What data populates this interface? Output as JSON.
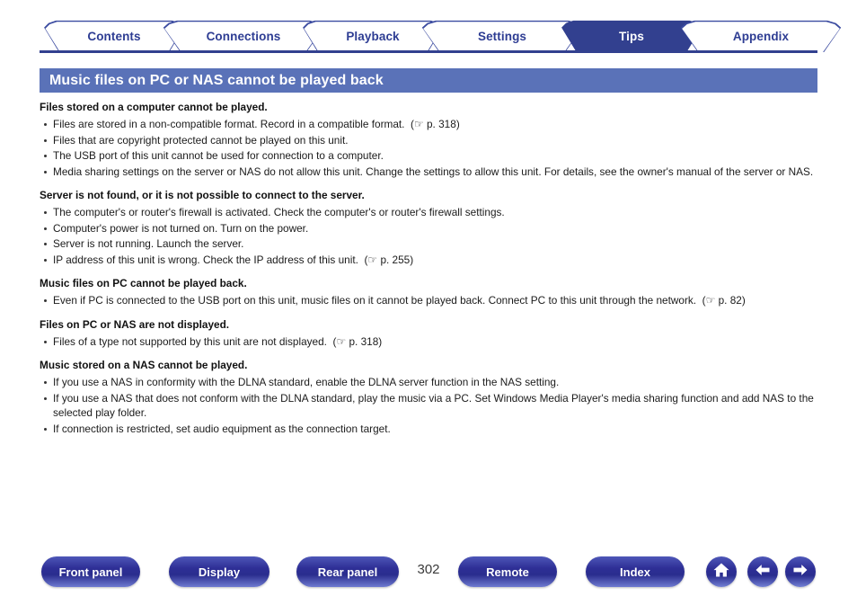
{
  "tabs": [
    {
      "label": "Contents",
      "active": false
    },
    {
      "label": "Connections",
      "active": false
    },
    {
      "label": "Playback",
      "active": false
    },
    {
      "label": "Settings",
      "active": false
    },
    {
      "label": "Tips",
      "active": true
    },
    {
      "label": "Appendix",
      "active": false
    }
  ],
  "page_title": "Music files on PC or NAS cannot be played back",
  "sections": [
    {
      "heading": "Files stored on a computer cannot be played.",
      "items": [
        {
          "text": "Files are stored in a non-compatible format. Record in a compatible format.",
          "ref": "p. 318"
        },
        {
          "text": "Files that are copyright protected cannot be played on this unit.",
          "ref": ""
        },
        {
          "text": "The USB port of this unit cannot be used for connection to a computer.",
          "ref": ""
        },
        {
          "text": "Media sharing settings on the server or NAS do not allow this unit. Change the settings to allow this unit. For details, see the owner's manual of the server or NAS.",
          "ref": ""
        }
      ]
    },
    {
      "heading": "Server is not found, or it is not possible to connect to the server.",
      "items": [
        {
          "text": "The computer's or router's firewall is activated. Check the computer's or router's firewall settings.",
          "ref": ""
        },
        {
          "text": "Computer's power is not turned on. Turn on the power.",
          "ref": ""
        },
        {
          "text": "Server is not running. Launch the server.",
          "ref": ""
        },
        {
          "text": "IP address of this unit is wrong. Check the IP address of this unit.",
          "ref": "p. 255"
        }
      ]
    },
    {
      "heading": "Music files on PC cannot be played back.",
      "items": [
        {
          "text": "Even if PC is connected to the USB port on this unit, music files on it cannot be played back. Connect PC to this unit through the network.",
          "ref": "p. 82"
        }
      ]
    },
    {
      "heading": "Files on PC or NAS are not displayed.",
      "items": [
        {
          "text": "Files of a type not supported by this unit are not displayed.",
          "ref": "p. 318"
        }
      ]
    },
    {
      "heading": "Music stored on a NAS cannot be played.",
      "items": [
        {
          "text": "If you use a NAS in conformity with the DLNA standard, enable the DLNA server function in the NAS setting.",
          "ref": ""
        },
        {
          "text": "If you use a NAS that does not conform with the DLNA standard, play the music via a PC. Set Windows Media Player's media sharing function and add NAS to the selected play folder.",
          "ref": ""
        },
        {
          "text": "If connection is restricted, set audio equipment as the connection target.",
          "ref": ""
        }
      ]
    }
  ],
  "footer": {
    "buttons": [
      {
        "label": "Front panel"
      },
      {
        "label": "Display"
      },
      {
        "label": "Rear panel"
      },
      {
        "label": "Remote"
      },
      {
        "label": "Index"
      }
    ],
    "page_number": "302",
    "icons": [
      {
        "name": "home-icon"
      },
      {
        "name": "arrow-left-icon"
      },
      {
        "name": "arrow-right-icon"
      }
    ]
  },
  "colors": {
    "tab_blue": "#32408f",
    "title_bar_blue": "#5a72b8",
    "button_blue": "#2e2f96"
  }
}
